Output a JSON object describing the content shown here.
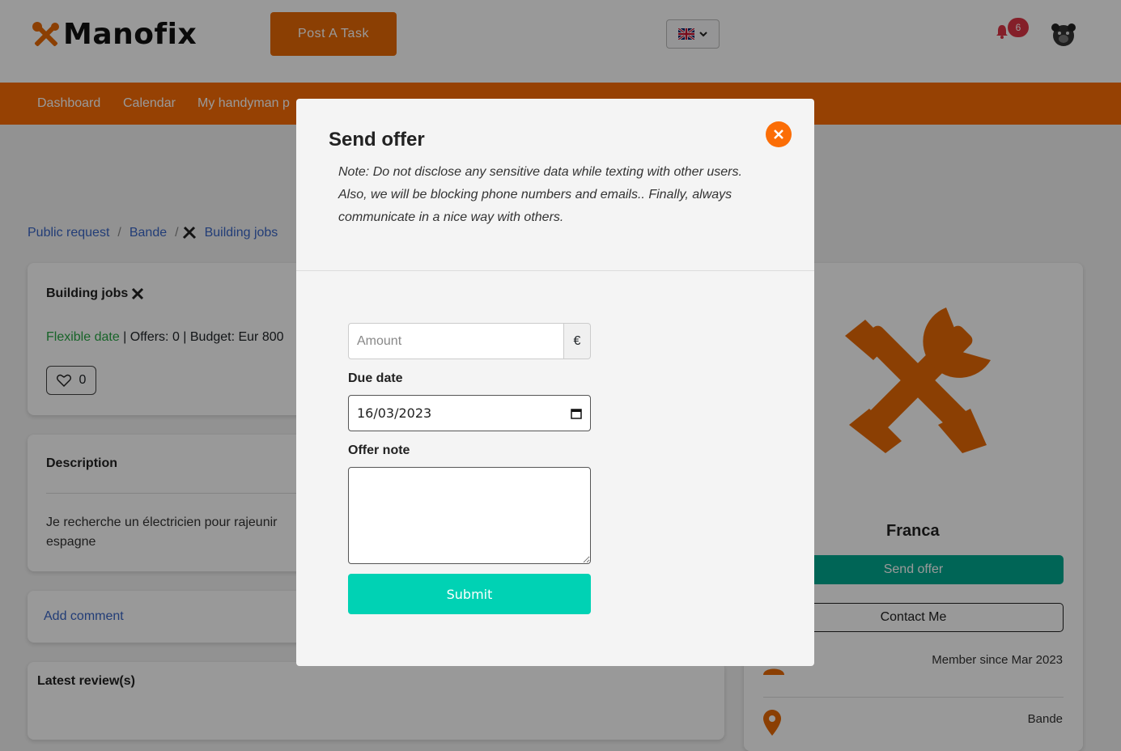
{
  "brand": {
    "name": "Manofix",
    "accent": "#fb6d06"
  },
  "header": {
    "post_task_label": "Post A Task",
    "notification_count": "6"
  },
  "nav": {
    "items": [
      "Dashboard",
      "Calendar",
      "My handyman p"
    ]
  },
  "breadcrumb": {
    "items": [
      "Public request",
      "Bande",
      "Building jobs"
    ]
  },
  "task": {
    "title": "Building jobs",
    "date_label": "Flexible date",
    "offers": "| Offers: 0 | Budget: Eur 800",
    "likes": "0"
  },
  "description": {
    "title": "Description",
    "text": "Je recherche un électricien pour rajeunir espagne"
  },
  "comments": {
    "add_label": "Add comment"
  },
  "reviews": {
    "title": "Latest review(s)"
  },
  "profile": {
    "name": "Franca",
    "send_offer_label": "Send offer",
    "contact_label": "Contact Me",
    "member_since": "Member since Mar 2023",
    "location": "Bande"
  },
  "modal": {
    "title": "Send offer",
    "note": "Note: Do not disclose any sensitive data while texting with other users. Also, we will be blocking phone numbers and emails.. Finally, always communicate in a nice way with others.",
    "amount_placeholder": "Amount",
    "currency": "€",
    "due_date_label": "Due date",
    "due_date_value": "16/03/2023",
    "offer_note_label": "Offer note",
    "submit_label": "Submit"
  }
}
